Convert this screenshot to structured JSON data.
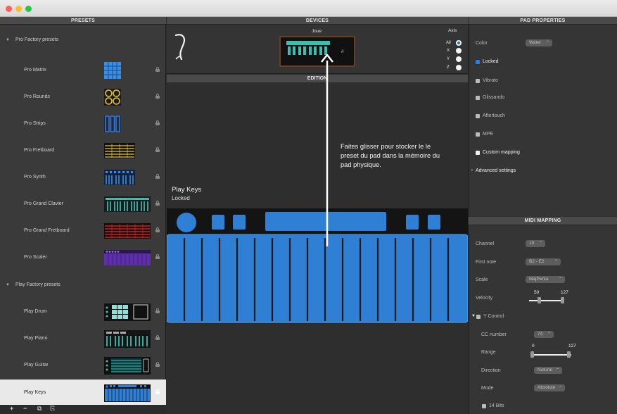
{
  "headers": {
    "presets": "PRESETS",
    "devices": "DEVICES",
    "pad_properties": "PAD PROPERTIES",
    "edition": "EDITION",
    "midi_mapping": "MIDI MAPPING"
  },
  "presets": {
    "groups": [
      {
        "label": "Pro Factory presets"
      },
      {
        "label": "Play Factory presets"
      }
    ],
    "items": [
      {
        "name": "Pro Matrix"
      },
      {
        "name": "Pro Rounds"
      },
      {
        "name": "Pro Strips"
      },
      {
        "name": "Pro Fretboard"
      },
      {
        "name": "Pro Synth"
      },
      {
        "name": "Pro Grand Clavier"
      },
      {
        "name": "Pro Grand Fretboard"
      },
      {
        "name": "Pro Scaler"
      },
      {
        "name": "Play Drum"
      },
      {
        "name": "Play Piano"
      },
      {
        "name": "Play Guitar"
      },
      {
        "name": "Play Keys",
        "selected": true
      }
    ],
    "toolbar": {
      "add": "+",
      "remove": "−",
      "duplicate": "⧉",
      "export": "⎘"
    }
  },
  "devices": {
    "device_name": "Joue",
    "axis_label": "Axis",
    "axis": [
      {
        "label": "All",
        "selected": true
      },
      {
        "label": "X"
      },
      {
        "label": "Y"
      },
      {
        "label": "Z"
      }
    ]
  },
  "edition": {
    "preset_title": "Play Keys",
    "preset_status": "Locked",
    "instruction": "Faites glisser pour stocker le le preset du pad dans la mémoire du pad physique."
  },
  "pad_properties": {
    "color_label": "Color",
    "color_value": "Water",
    "locked": "Locked",
    "vibrato": "Vibrato",
    "glissando": "Glissando",
    "aftertouch": "Aftertouch",
    "mpe": "MPE",
    "custom_mapping": "Custom mapping",
    "advanced_settings": "Advanced settings"
  },
  "midi_mapping": {
    "channel_label": "Channel",
    "channel_value": "10",
    "first_note_label": "First note",
    "first_note_value": "B2 - E2",
    "scale_label": "Scale",
    "scale_value": "MajPenta",
    "velocity_label": "Velocity",
    "velocity_min": "50",
    "velocity_max": "127",
    "y_control": "Y Control",
    "cc_label": "CC number",
    "cc_value": "74",
    "range_label": "Range",
    "range_min": "0",
    "range_max": "127",
    "direction_label": "Direction",
    "direction_value": "Natural",
    "mode_label": "Mode",
    "mode_value": "Absolute",
    "bits14": "14 Bits"
  },
  "colors": {
    "pad_blue": "#2f7fd4",
    "accent": "#2d7be5",
    "mac_red": "#fe5f57",
    "mac_yellow": "#febc2e",
    "mac_green": "#28c840"
  }
}
